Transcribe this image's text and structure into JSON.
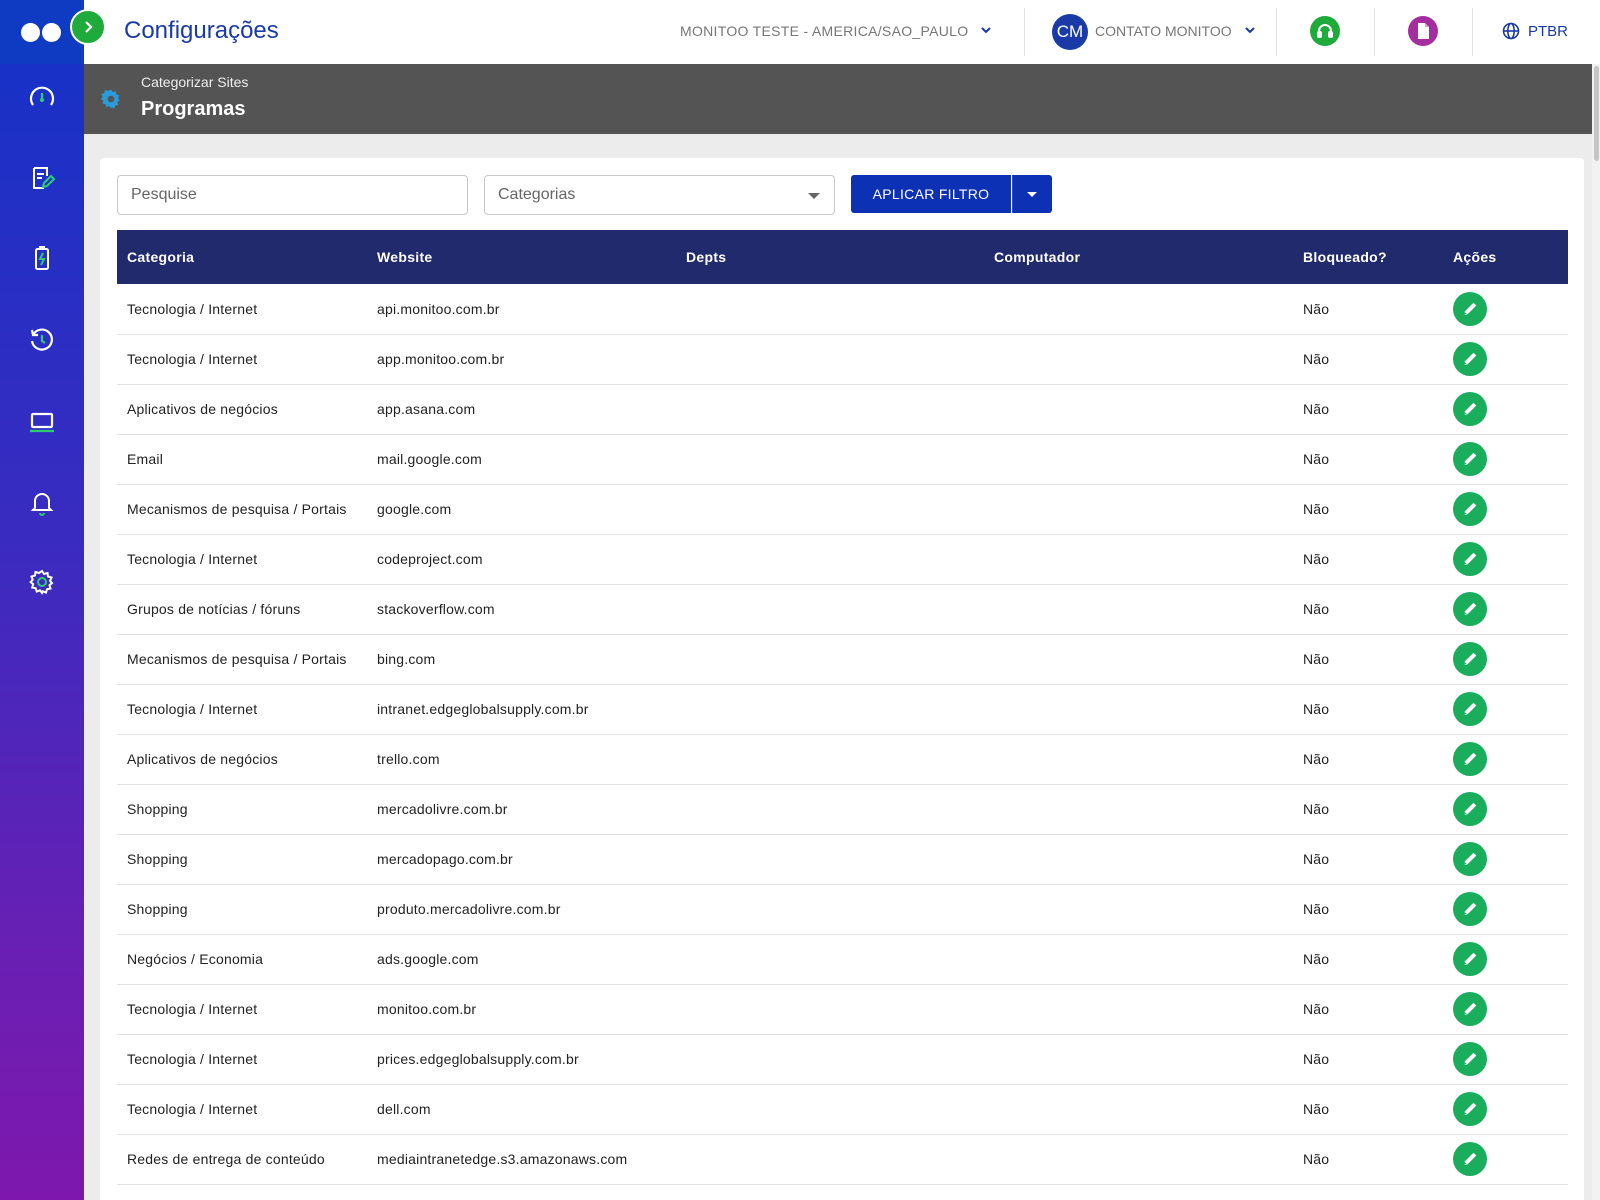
{
  "header": {
    "title": "Configurações",
    "tenant": "MONITOO TESTE - AMERICA/SAO_PAULO",
    "avatar_initials": "CM",
    "user_name": "CONTATO MONITOO",
    "language": "PTBR",
    "support_icon": "headset-icon",
    "document_icon": "document-icon",
    "globe_icon": "globe-icon",
    "colors": {
      "brand": "#1a3aa8",
      "support": "#1faa3c",
      "document": "#a42ea0"
    }
  },
  "sidebar": {
    "items": [
      {
        "icon": "dashboard-gauge-icon"
      },
      {
        "icon": "report-edit-icon"
      },
      {
        "icon": "battery-icon"
      },
      {
        "icon": "history-icon"
      },
      {
        "icon": "laptop-icon"
      },
      {
        "icon": "bell-icon"
      },
      {
        "icon": "gear-icon"
      }
    ]
  },
  "subheader": {
    "breadcrumb": "Categorizar Sites",
    "title": "Programas"
  },
  "filters": {
    "search_placeholder": "Pesquise",
    "category_placeholder": "Categorias",
    "apply_label": "APLICAR FILTRO"
  },
  "table": {
    "columns": [
      "Categoria",
      "Website",
      "Depts",
      "Computador",
      "Bloqueado?",
      "Ações"
    ],
    "rows": [
      {
        "categoria": "Tecnologia / Internet",
        "website": "api.monitoo.com.br",
        "depts": "",
        "computador": "",
        "bloqueado": "Não"
      },
      {
        "categoria": "Tecnologia / Internet",
        "website": "app.monitoo.com.br",
        "depts": "",
        "computador": "",
        "bloqueado": "Não"
      },
      {
        "categoria": "Aplicativos de negócios",
        "website": "app.asana.com",
        "depts": "",
        "computador": "",
        "bloqueado": "Não"
      },
      {
        "categoria": "Email",
        "website": "mail.google.com",
        "depts": "",
        "computador": "",
        "bloqueado": "Não"
      },
      {
        "categoria": "Mecanismos de pesquisa / Portais",
        "website": "google.com",
        "depts": "",
        "computador": "",
        "bloqueado": "Não"
      },
      {
        "categoria": "Tecnologia / Internet",
        "website": "codeproject.com",
        "depts": "",
        "computador": "",
        "bloqueado": "Não"
      },
      {
        "categoria": "Grupos de notícias / fóruns",
        "website": "stackoverflow.com",
        "depts": "",
        "computador": "",
        "bloqueado": "Não"
      },
      {
        "categoria": "Mecanismos de pesquisa / Portais",
        "website": "bing.com",
        "depts": "",
        "computador": "",
        "bloqueado": "Não"
      },
      {
        "categoria": "Tecnologia / Internet",
        "website": "intranet.edgeglobalsupply.com.br",
        "depts": "",
        "computador": "",
        "bloqueado": "Não"
      },
      {
        "categoria": "Aplicativos de negócios",
        "website": "trello.com",
        "depts": "",
        "computador": "",
        "bloqueado": "Não"
      },
      {
        "categoria": "Shopping",
        "website": "mercadolivre.com.br",
        "depts": "",
        "computador": "",
        "bloqueado": "Não"
      },
      {
        "categoria": "Shopping",
        "website": "mercadopago.com.br",
        "depts": "",
        "computador": "",
        "bloqueado": "Não"
      },
      {
        "categoria": "Shopping",
        "website": "produto.mercadolivre.com.br",
        "depts": "",
        "computador": "",
        "bloqueado": "Não"
      },
      {
        "categoria": "Negócios / Economia",
        "website": "ads.google.com",
        "depts": "",
        "computador": "",
        "bloqueado": "Não"
      },
      {
        "categoria": "Tecnologia / Internet",
        "website": "monitoo.com.br",
        "depts": "",
        "computador": "",
        "bloqueado": "Não"
      },
      {
        "categoria": "Tecnologia / Internet",
        "website": "prices.edgeglobalsupply.com.br",
        "depts": "",
        "computador": "",
        "bloqueado": "Não"
      },
      {
        "categoria": "Tecnologia / Internet",
        "website": "dell.com",
        "depts": "",
        "computador": "",
        "bloqueado": "Não"
      },
      {
        "categoria": "Redes de entrega de conteúdo",
        "website": "mediaintranetedge.s3.amazonaws.com",
        "depts": "",
        "computador": "",
        "bloqueado": "Não"
      }
    ],
    "action_icon": "pencil-edit-icon",
    "action_color": "#1aae5c"
  }
}
